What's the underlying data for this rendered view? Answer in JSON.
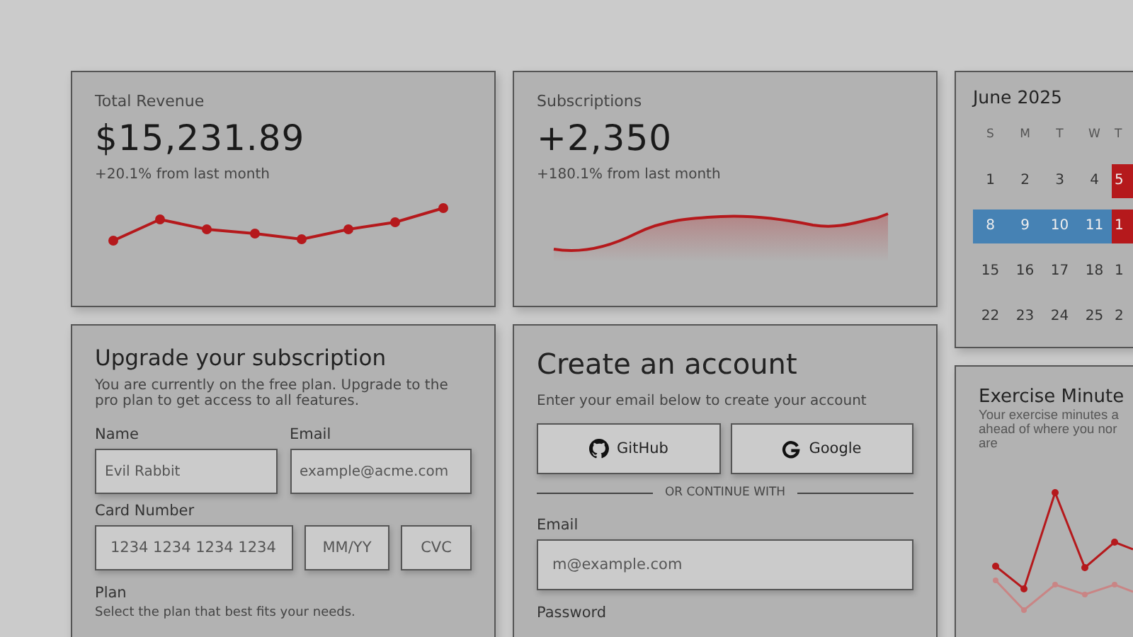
{
  "revenue_card": {
    "title": "Total Revenue",
    "value": "$15,231.89",
    "change": "+20.1% from last month"
  },
  "subscriptions_card": {
    "title": "Subscriptions",
    "value": "+2,350",
    "change": "+180.1% from last month"
  },
  "calendar": {
    "month": "June 2025",
    "weekdays": [
      "S",
      "M",
      "T",
      "W",
      "T"
    ],
    "weeks": [
      [
        {
          "day": "1",
          "in_range": false,
          "marked": false
        },
        {
          "day": "2",
          "in_range": false,
          "marked": false
        },
        {
          "day": "3",
          "in_range": false,
          "marked": false
        },
        {
          "day": "4",
          "in_range": false,
          "marked": false
        },
        {
          "day": "5",
          "in_range": false,
          "marked": true
        }
      ],
      [
        {
          "day": "8",
          "in_range": true,
          "marked": false
        },
        {
          "day": "9",
          "in_range": true,
          "marked": false
        },
        {
          "day": "10",
          "in_range": true,
          "marked": false
        },
        {
          "day": "11",
          "in_range": true,
          "marked": false
        },
        {
          "day": "1",
          "in_range": false,
          "marked": true
        }
      ],
      [
        {
          "day": "15",
          "in_range": false,
          "marked": false
        },
        {
          "day": "16",
          "in_range": false,
          "marked": false
        },
        {
          "day": "17",
          "in_range": false,
          "marked": false
        },
        {
          "day": "18",
          "in_range": false,
          "marked": false
        },
        {
          "day": "1",
          "in_range": false,
          "marked": false
        }
      ],
      [
        {
          "day": "22",
          "in_range": false,
          "marked": false
        },
        {
          "day": "23",
          "in_range": false,
          "marked": false
        },
        {
          "day": "24",
          "in_range": false,
          "marked": false
        },
        {
          "day": "25",
          "in_range": false,
          "marked": false
        },
        {
          "day": "2",
          "in_range": false,
          "marked": false
        }
      ]
    ]
  },
  "upgrade": {
    "title": "Upgrade your subscription",
    "description": "You are currently on the free plan. Upgrade to the pro plan to get access to all features.",
    "name_label": "Name",
    "name_placeholder": "Evil Rabbit",
    "email_label": "Email",
    "email_placeholder": "example@acme.com",
    "card_label": "Card Number",
    "card_placeholder": "1234 1234 1234 1234",
    "expiry_placeholder": "MM/YY",
    "cvc_placeholder": "CVC",
    "plan_label": "Plan",
    "plan_hint": "Select the plan that best fits your needs."
  },
  "account": {
    "title": "Create an account",
    "description": "Enter your email below to create your account",
    "buttons": [
      {
        "label": "GitHub",
        "kind": "github"
      },
      {
        "label": "Google",
        "kind": "google"
      }
    ],
    "divider": "OR CONTINUE WITH",
    "email_label": "Email",
    "email_placeholder": "m@example.com",
    "password_label": "Password"
  },
  "exercise": {
    "title": "Exercise Minute",
    "description_lines": [
      "Your exercise minutes a",
      "ahead of where you nor",
      "are"
    ]
  }
}
